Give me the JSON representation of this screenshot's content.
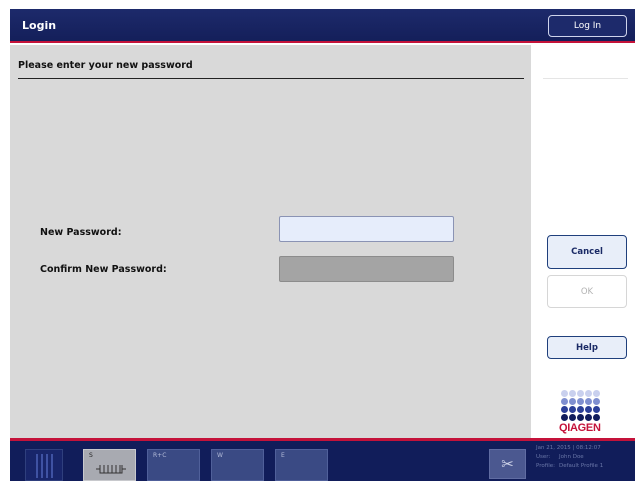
{
  "header": {
    "title": "Login",
    "login_button": "Log In"
  },
  "main": {
    "title": "Please enter your new password",
    "new_password_label": "New Password:",
    "new_password_value": "",
    "confirm_password_label": "Confirm New Password:",
    "confirm_password_value": ""
  },
  "side": {
    "cancel": "Cancel",
    "ok": "OK",
    "help": "Help",
    "logo_text": "QIAGEN"
  },
  "footer": {
    "tabs": [
      {
        "label": "S"
      },
      {
        "label": "R+C"
      },
      {
        "label": "W"
      },
      {
        "label": "E"
      }
    ],
    "date_time": "Jan 21, 2015 | 08:12:07",
    "user_key": "User:",
    "user_value": "John Doe",
    "profile_key": "Profile:",
    "profile_value": "Default Profile 1"
  },
  "colors": {
    "header_bg": "#1d2a6b",
    "accent_red": "#c4123a",
    "panel_bg": "#d9d9d9",
    "footer_bg": "#111d5a"
  },
  "icons": [
    "rack-icon",
    "sample-strip-icon",
    "tools-icon",
    "qiagen-logo"
  ]
}
